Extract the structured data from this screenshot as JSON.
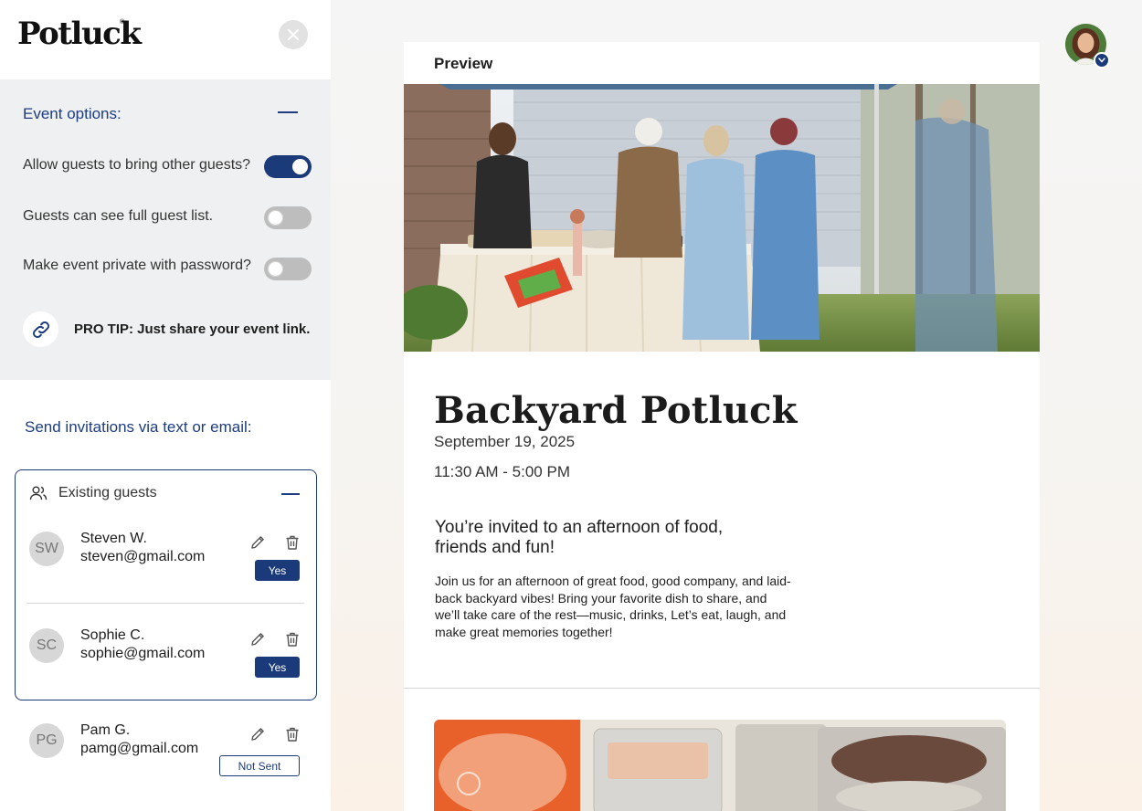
{
  "app": {
    "logo_text": "Potluck",
    "logo_mark": "®"
  },
  "sidebar": {
    "event_options": {
      "title": "Event options:",
      "options": [
        {
          "label": "Allow guests to bring other guests?",
          "enabled": true
        },
        {
          "label": "Guests can see full guest list.",
          "enabled": false
        },
        {
          "label": "Make event private with password?",
          "enabled": false
        }
      ],
      "tip": "PRO TIP: Just share your event link."
    },
    "send_title": "Send invitations via text or email:",
    "guests_header": "Existing guests",
    "guests": [
      {
        "initials": "SW",
        "name": "Steven W.",
        "email": "steven@gmail.com",
        "status": "Yes"
      },
      {
        "initials": "SC",
        "name": "Sophie C.",
        "email": "sophie@gmail.com",
        "status": "Yes"
      },
      {
        "initials": "PG",
        "name": "Pam G.",
        "email": "pamg@gmail.com",
        "status": "Not Sent"
      }
    ]
  },
  "preview": {
    "header": "Preview",
    "event_title": "Backyard Potluck",
    "date": "September 19, 2025",
    "time": "11:30 AM - 5:00 PM",
    "headline": "You’re invited to an afternoon of food, friends and fun!",
    "body": "Join us for an afternoon of great food, good company, and laid-back backyard vibes! Bring your favorite dish to share, and we’ll take care of the rest—music, drinks, Let’s eat, laugh, and make great memories together!"
  },
  "colors": {
    "accent": "#1b3a7a",
    "panel": "#eff0f1",
    "toggle_off": "#bdbdbd"
  },
  "icons": [
    "close-icon",
    "minus-icon",
    "link-icon",
    "people-icon",
    "pencil-icon",
    "trash-icon",
    "chevron-down-icon"
  ]
}
